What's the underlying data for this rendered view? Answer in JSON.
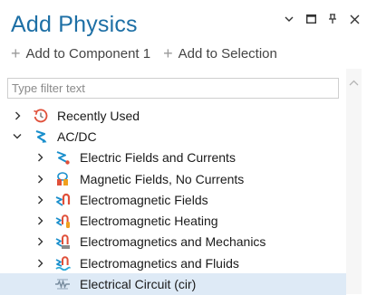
{
  "window": {
    "title": "Add Physics",
    "controls": [
      "chevron-down",
      "maximize",
      "pin",
      "close"
    ]
  },
  "toolbar": {
    "add_to_component": "Add to Component 1",
    "add_to_selection": "Add to Selection"
  },
  "filter": {
    "placeholder": "Type filter text",
    "value": ""
  },
  "tree": {
    "recently_used": "Recently Used",
    "acdc": "AC/DC",
    "items": [
      {
        "label": "Electric Fields and Currents",
        "icon": "electric-fields-icon"
      },
      {
        "label": "Magnetic Fields, No Currents",
        "icon": "magnetic-fields-icon"
      },
      {
        "label": "Electromagnetic Fields",
        "icon": "electromagnetic-fields-icon"
      },
      {
        "label": "Electromagnetic Heating",
        "icon": "electromagnetic-heating-icon"
      },
      {
        "label": "Electromagnetics and Mechanics",
        "icon": "electromagnetics-mechanics-icon"
      },
      {
        "label": "Electromagnetics and Fluids",
        "icon": "electromagnetics-fluids-icon"
      },
      {
        "label": "Electrical Circuit (cir)",
        "icon": "electrical-circuit-icon"
      }
    ]
  },
  "colors": {
    "title": "#1d6fa5",
    "selected_row": "#deeaf6"
  }
}
